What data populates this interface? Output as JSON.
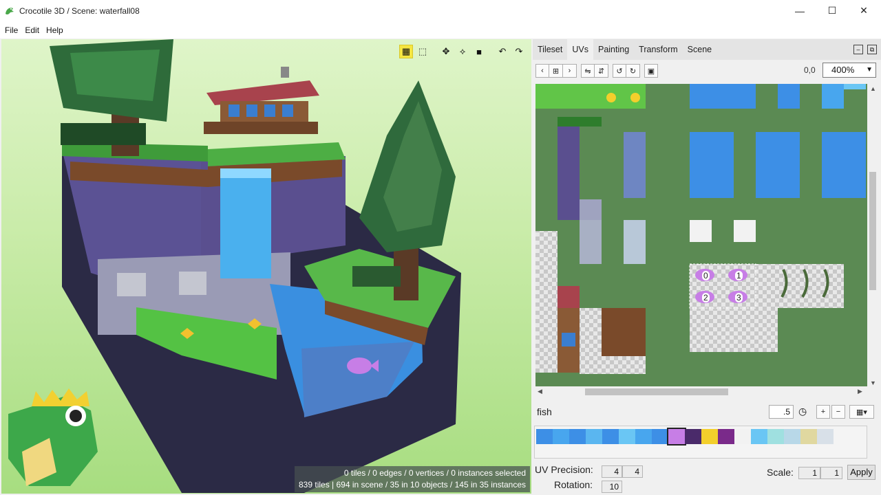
{
  "window": {
    "title": "Crocotile 3D / Scene: waterfall08",
    "minimize": "—",
    "maximize": "☐",
    "close": "✕"
  },
  "menu": [
    "File",
    "Edit",
    "Help"
  ],
  "viewport": {
    "status_line1": "0 tiles / 0 edges / 0 vertices / 0 instances selected",
    "status_line2": "839 tiles | 694 in scene / 35 in 10 objects / 145 in 35 instances"
  },
  "panel": {
    "tabs": [
      "Tileset",
      "UVs",
      "Painting",
      "Transform",
      "Scene"
    ],
    "active_tab": "UVs",
    "coord": "0,0",
    "zoom": "400%",
    "tile_name": "fish",
    "value_field": ".5",
    "uv_precision_label": "UV Precision:",
    "uv_precision_x": "4",
    "uv_precision_y": "4",
    "rotation_label": "Rotation:",
    "rotation_value": "10",
    "scale_label": "Scale:",
    "scale_x": "1",
    "scale_y": "1",
    "apply_label": "Apply",
    "selection_indices": [
      "0",
      "1",
      "2",
      "3"
    ]
  },
  "colors": {
    "accent_toolbar": "#f5e642",
    "uv_bg": "#5b8a53",
    "water": "#3a8fe0",
    "fish": "#c77ee6"
  }
}
